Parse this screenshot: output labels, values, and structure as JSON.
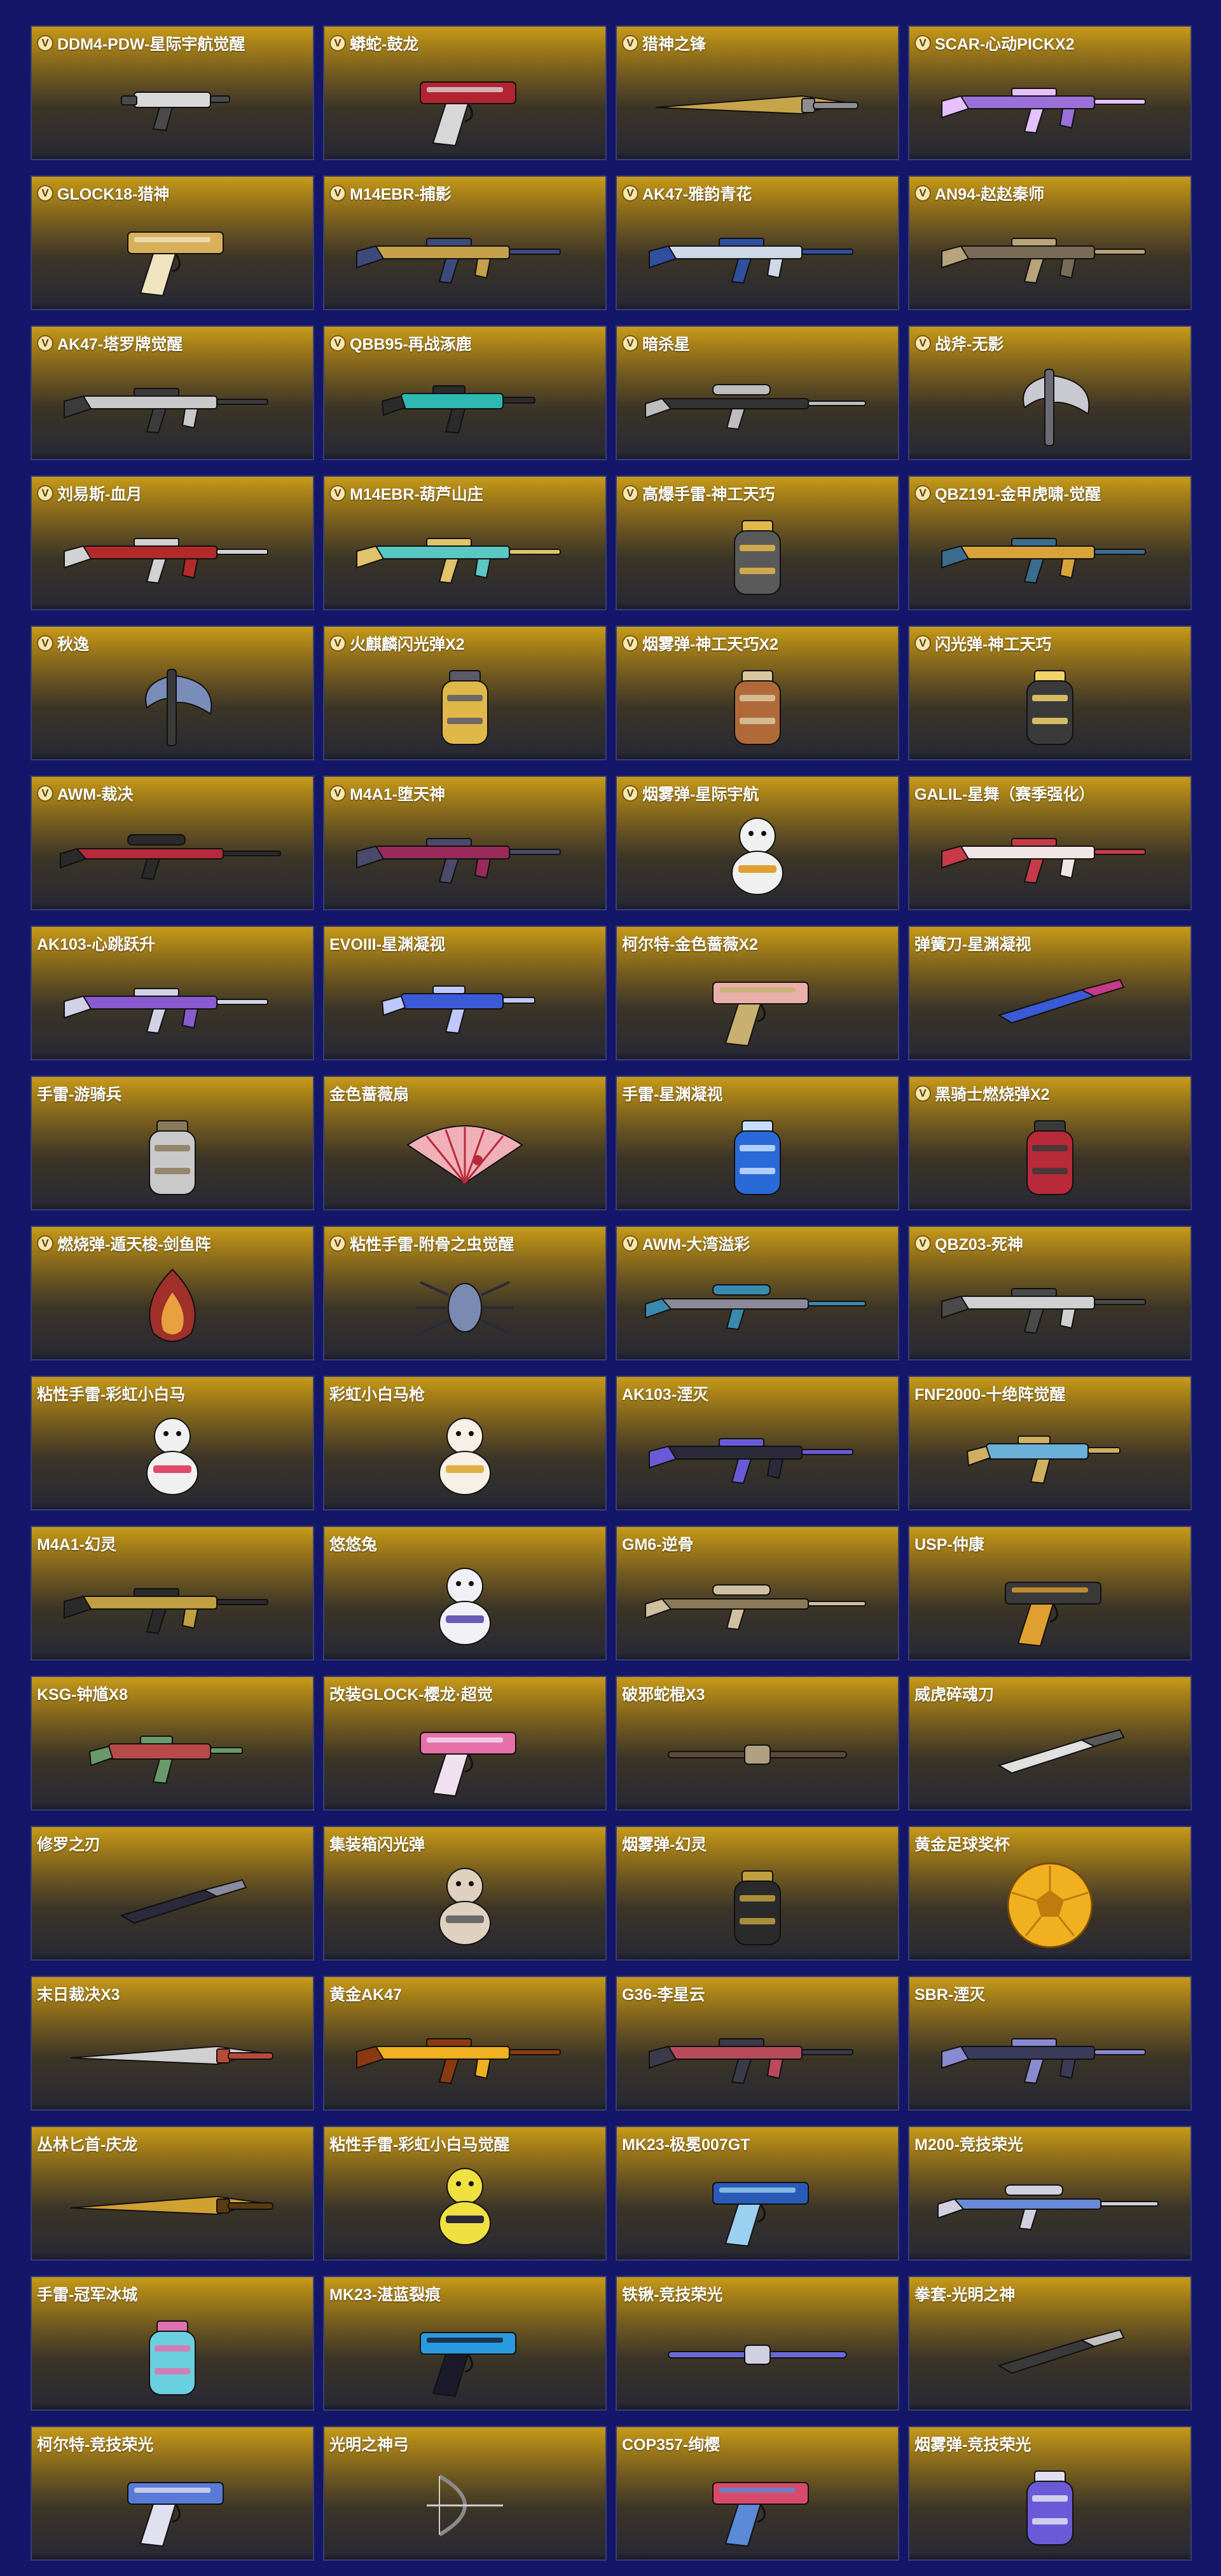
{
  "colors": {
    "page_background": "#14166a",
    "card_gold": "#c69a1a",
    "card_dark": "#272835",
    "title_text": "#ffffff",
    "badge": "#f6e6b0"
  },
  "items": [
    {
      "name": "DDM4-PDW-星际宇航觉醒",
      "v": true,
      "icon": "gun-small-icon",
      "c1": "#d9d9d9",
      "c2": "#4a4a4a"
    },
    {
      "name": "蟒蛇-鼓龙",
      "v": true,
      "icon": "revolver-icon",
      "c1": "#b32331",
      "c2": "#d7d7d7"
    },
    {
      "name": "猎神之锋",
      "v": true,
      "icon": "blade-icon",
      "c1": "#c7a44a",
      "c2": "#8f8f8f"
    },
    {
      "name": "SCAR-心动PICKX2",
      "v": true,
      "icon": "rifle-icon",
      "c1": "#9b70d8",
      "c2": "#e7c0ff"
    },
    {
      "name": "GLOCK18-猎神",
      "v": true,
      "icon": "pistol-icon",
      "c1": "#d9b05a",
      "c2": "#f0e3c0"
    },
    {
      "name": "M14EBR-捕影",
      "v": true,
      "icon": "rifle-icon",
      "c1": "#c6a04a",
      "c2": "#3d4a7a"
    },
    {
      "name": "AK47-雅韵青花",
      "v": true,
      "icon": "rifle-icon",
      "c1": "#cfd8e6",
      "c2": "#2f4f9f"
    },
    {
      "name": "AN94-赵赵秦师",
      "v": true,
      "icon": "rifle-icon",
      "c1": "#7a6b56",
      "c2": "#b8a47a"
    },
    {
      "name": "AK47-塔罗牌觉醒",
      "v": true,
      "icon": "rifle-icon",
      "c1": "#c9c9c9",
      "c2": "#3b3b3b"
    },
    {
      "name": "QBB95-再战涿鹿",
      "v": true,
      "icon": "smg-icon",
      "c1": "#2fb9b2",
      "c2": "#2b2b2b"
    },
    {
      "name": "暗杀星",
      "v": true,
      "icon": "sniper-icon",
      "c1": "#333333",
      "c2": "#bdbdbd"
    },
    {
      "name": "战斧-无影",
      "v": true,
      "icon": "axe-icon",
      "c1": "#c9c9d2",
      "c2": "#6b6b75"
    },
    {
      "name": "刘易斯-血月",
      "v": true,
      "icon": "rifle-icon",
      "c1": "#b32a2a",
      "c2": "#d2d2d2"
    },
    {
      "name": "M14EBR-葫芦山庄",
      "v": true,
      "icon": "rifle-icon",
      "c1": "#59c7c2",
      "c2": "#e0c36a"
    },
    {
      "name": "高爆手雷-神工天巧",
      "v": true,
      "icon": "grenade-icon",
      "c1": "#5a5a5a",
      "c2": "#e3b84a"
    },
    {
      "name": "QBZ191-金甲虎啸-觉醒",
      "v": true,
      "icon": "rifle-icon",
      "c1": "#d8a43a",
      "c2": "#3a6d8f"
    },
    {
      "name": "秋逸",
      "v": true,
      "icon": "axe-icon",
      "c1": "#7a8db8",
      "c2": "#3a3a3a"
    },
    {
      "name": "火麒麟闪光弹X2",
      "v": true,
      "icon": "grenade-icon",
      "c1": "#e0b84a",
      "c2": "#5a5a6a"
    },
    {
      "name": "烟雾弹-神工天巧X2",
      "v": true,
      "icon": "grenade-icon",
      "c1": "#b06a3a",
      "c2": "#d9c8a0"
    },
    {
      "name": "闪光弹-神工天巧",
      "v": true,
      "icon": "grenade-icon",
      "c1": "#3a3a3a",
      "c2": "#f2d46a"
    },
    {
      "name": "AWM-裁决",
      "v": true,
      "icon": "sniper-icon",
      "c1": "#b82a3a",
      "c2": "#2a2a2a"
    },
    {
      "name": "M4A1-堕天神",
      "v": true,
      "icon": "rifle-icon",
      "c1": "#9a2a5a",
      "c2": "#4a4a6a"
    },
    {
      "name": "烟雾弹-星际宇航",
      "v": true,
      "icon": "figure-icon",
      "c1": "#f0f0f0",
      "c2": "#e0a030"
    },
    {
      "name": "GALIL-星舞（赛季强化）",
      "v": false,
      "icon": "rifle-icon",
      "c1": "#f0e6e6",
      "c2": "#c83a4a"
    },
    {
      "name": "AK103-心跳跃升",
      "v": false,
      "icon": "rifle-icon",
      "c1": "#8a5ad0",
      "c2": "#d2d2e6"
    },
    {
      "name": "EVOIII-星渊凝视",
      "v": false,
      "icon": "smg-icon",
      "c1": "#3a5ad8",
      "c2": "#c0c8ff"
    },
    {
      "name": "柯尔特-金色蔷薇X2",
      "v": false,
      "icon": "pistol-icon",
      "c1": "#e8b0a8",
      "c2": "#c8b070"
    },
    {
      "name": "弹簧刀-星渊凝视",
      "v": false,
      "icon": "knife-icon",
      "c1": "#3a5ad8",
      "c2": "#c83a8a"
    },
    {
      "name": "手雷-游骑兵",
      "v": false,
      "icon": "grenade-icon",
      "c1": "#c9c9c9",
      "c2": "#8a7a5a"
    },
    {
      "name": "金色蔷薇扇",
      "v": false,
      "icon": "fan-icon",
      "c1": "#f0b0b8",
      "c2": "#b82a3a"
    },
    {
      "name": "手雷-星渊凝视",
      "v": false,
      "icon": "grenade-icon",
      "c1": "#2a6ad8",
      "c2": "#c8e0ff"
    },
    {
      "name": "黑骑士燃烧弹X2",
      "v": true,
      "icon": "grenade-icon",
      "c1": "#b82a3a",
      "c2": "#3a3a3a"
    },
    {
      "name": "燃烧弹-遁天梭-剑鱼阵",
      "v": true,
      "icon": "flame-icon",
      "c1": "#a0302a",
      "c2": "#e8a040"
    },
    {
      "name": "粘性手雷-附骨之虫觉醒",
      "v": true,
      "icon": "bug-icon",
      "c1": "#7a8ab0",
      "c2": "#2a2a3a"
    },
    {
      "name": "AWM-大湾溢彩",
      "v": true,
      "icon": "sniper-icon",
      "c1": "#8a8a9a",
      "c2": "#3a8ab0"
    },
    {
      "name": "QBZ03-死神",
      "v": true,
      "icon": "rifle-icon",
      "c1": "#d0d0d0",
      "c2": "#4a4a4a"
    },
    {
      "name": "粘性手雷-彩虹小白马",
      "v": false,
      "icon": "figure-icon",
      "c1": "#f0f0f0",
      "c2": "#e04a6a"
    },
    {
      "name": "彩虹小白马枪",
      "v": false,
      "icon": "figure-icon",
      "c1": "#f6f0e6",
      "c2": "#e0b040"
    },
    {
      "name": "AK103-湮灭",
      "v": false,
      "icon": "rifle-icon",
      "c1": "#2a2a3a",
      "c2": "#6a5ad8"
    },
    {
      "name": "FNF2000-十绝阵觉醒",
      "v": false,
      "icon": "smg-icon",
      "c1": "#6ab0d8",
      "c2": "#d0b060"
    },
    {
      "name": "M4A1-幻灵",
      "v": false,
      "icon": "rifle-icon",
      "c1": "#c0a040",
      "c2": "#2a2a2a"
    },
    {
      "name": "悠悠兔",
      "v": false,
      "icon": "figure-icon",
      "c1": "#f0f0f6",
      "c2": "#6a5ab8"
    },
    {
      "name": "GM6-逆骨",
      "v": false,
      "icon": "sniper-icon",
      "c1": "#8a7a5a",
      "c2": "#d0c0a0"
    },
    {
      "name": "USP-仲康",
      "v": false,
      "icon": "pistol-icon",
      "c1": "#3a3a3a",
      "c2": "#e0a030"
    },
    {
      "name": "KSG-钟馗X8",
      "v": false,
      "icon": "smg-icon",
      "c1": "#b84a4a",
      "c2": "#6a9a6a"
    },
    {
      "name": "改装GLOCK-樱龙·超觉",
      "v": false,
      "icon": "pistol-icon",
      "c1": "#e870a8",
      "c2": "#f0e0f0"
    },
    {
      "name": "破邪蛇棍X3",
      "v": false,
      "icon": "staff-icon",
      "c1": "#5a4a3a",
      "c2": "#b0a080"
    },
    {
      "name": "威虎碎魂刀",
      "v": false,
      "icon": "knife-icon",
      "c1": "#e0e0e0",
      "c2": "#5a5a5a"
    },
    {
      "name": "修罗之刃",
      "v": false,
      "icon": "knife-icon",
      "c1": "#2a2a3a",
      "c2": "#8a8aa0"
    },
    {
      "name": "集装箱闪光弹",
      "v": false,
      "icon": "figure-icon",
      "c1": "#e0d0c0",
      "c2": "#6a6a6a"
    },
    {
      "name": "烟雾弹-幻灵",
      "v": false,
      "icon": "grenade-icon",
      "c1": "#2a2a2a",
      "c2": "#c0a040"
    },
    {
      "name": "黄金足球奖杯",
      "v": false,
      "icon": "ball-icon",
      "c1": "#f0b020",
      "c2": "#c07a10"
    },
    {
      "name": "末日裁决X3",
      "v": false,
      "icon": "blade-icon",
      "c1": "#d0d0d0",
      "c2": "#b84a3a"
    },
    {
      "name": "黄金AK47",
      "v": false,
      "icon": "rifle-icon",
      "c1": "#f0b020",
      "c2": "#8a3a10"
    },
    {
      "name": "G36-李星云",
      "v": false,
      "icon": "rifle-icon",
      "c1": "#b84a5a",
      "c2": "#3a3a4a"
    },
    {
      "name": "SBR-湮灭",
      "v": false,
      "icon": "rifle-icon",
      "c1": "#3a3a5a",
      "c2": "#8a8ad0"
    },
    {
      "name": "丛林匕首-庆龙",
      "v": false,
      "icon": "blade-icon",
      "c1": "#d0a030",
      "c2": "#5a3a10"
    },
    {
      "name": "粘性手雷-彩虹小白马觉醒",
      "v": false,
      "icon": "figure-icon",
      "c1": "#f0e040",
      "c2": "#2a2a3a"
    },
    {
      "name": "MK23-极冕007GT",
      "v": false,
      "icon": "pistol-icon",
      "c1": "#2a5ab8",
      "c2": "#9ad0f0"
    },
    {
      "name": "M200-竞技荣光",
      "v": false,
      "icon": "sniper-icon",
      "c1": "#6a8ad8",
      "c2": "#d0d0e0"
    },
    {
      "name": "手雷-冠军冰城",
      "v": false,
      "icon": "grenade-icon",
      "c1": "#6ad0e0",
      "c2": "#e070b0"
    },
    {
      "name": "MK23-湛蓝裂痕",
      "v": false,
      "icon": "pistol-icon",
      "c1": "#2a9ae0",
      "c2": "#1a1a2a"
    },
    {
      "name": "铁锹-竞技荣光",
      "v": false,
      "icon": "staff-icon",
      "c1": "#6a6ad8",
      "c2": "#d0d0e0"
    },
    {
      "name": "拳套-光明之神",
      "v": false,
      "icon": "knife-icon",
      "c1": "#3a3a3a",
      "c2": "#c0c0c0"
    },
    {
      "name": "柯尔特-竞技荣光",
      "v": false,
      "icon": "pistol-icon",
      "c1": "#5a7ad8",
      "c2": "#e0e0f0"
    },
    {
      "name": "光明之神弓",
      "v": false,
      "icon": "bow-icon",
      "c1": "#8a8a8a",
      "c2": "#d0d0d0"
    },
    {
      "name": "COP357-绚樱",
      "v": false,
      "icon": "pistol-icon",
      "c1": "#d84a6a",
      "c2": "#5a8ad8"
    },
    {
      "name": "烟雾弹-竞技荣光",
      "v": false,
      "icon": "grenade-icon",
      "c1": "#6a5ad8",
      "c2": "#e0e0f0"
    }
  ],
  "badge_label": "V"
}
